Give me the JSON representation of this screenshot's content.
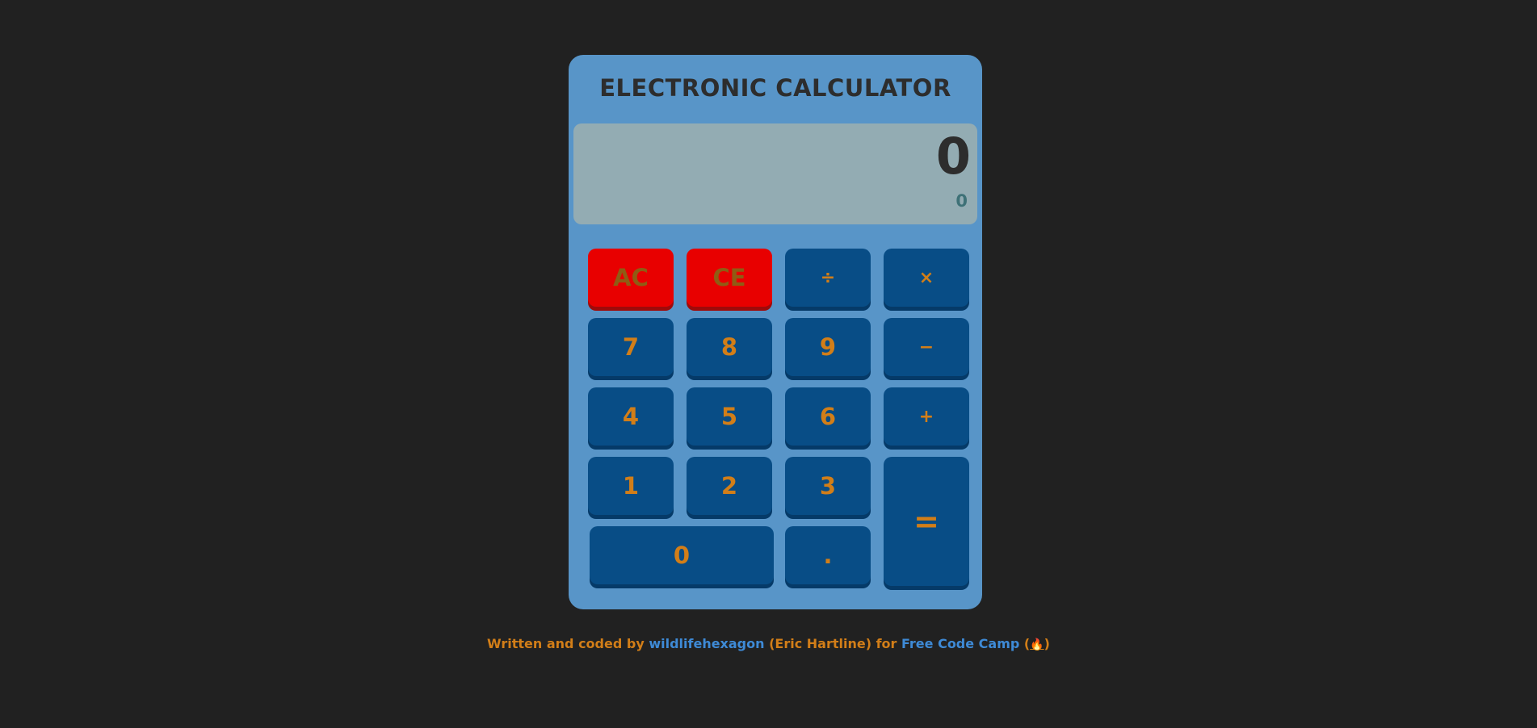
{
  "calculator": {
    "title": "ELECTRONIC CALCULATOR",
    "display_main": "0",
    "display_sub": "0",
    "colors": {
      "background": "#5895c8",
      "display": "#93acb3",
      "button": "#084d86",
      "button_clear": "#e80000",
      "button_text": "#d27e18"
    },
    "buttons": {
      "ac": "AC",
      "ce": "CE",
      "divide": "÷",
      "multiply": "×",
      "seven": "7",
      "eight": "8",
      "nine": "9",
      "subtract": "−",
      "four": "4",
      "five": "5",
      "six": "6",
      "add": "+",
      "one": "1",
      "two": "2",
      "three": "3",
      "equals": "=",
      "zero": "0",
      "decimal": "."
    }
  },
  "footer": {
    "prefix": "Written and coded by ",
    "author_link": "wildlifehexagon",
    "author_name": " (Eric Hartline) for ",
    "fcc_link": "Free Code Camp",
    "fcc_icon_open": " (",
    "fcc_icon": "🔥",
    "fcc_icon_close": ")"
  }
}
